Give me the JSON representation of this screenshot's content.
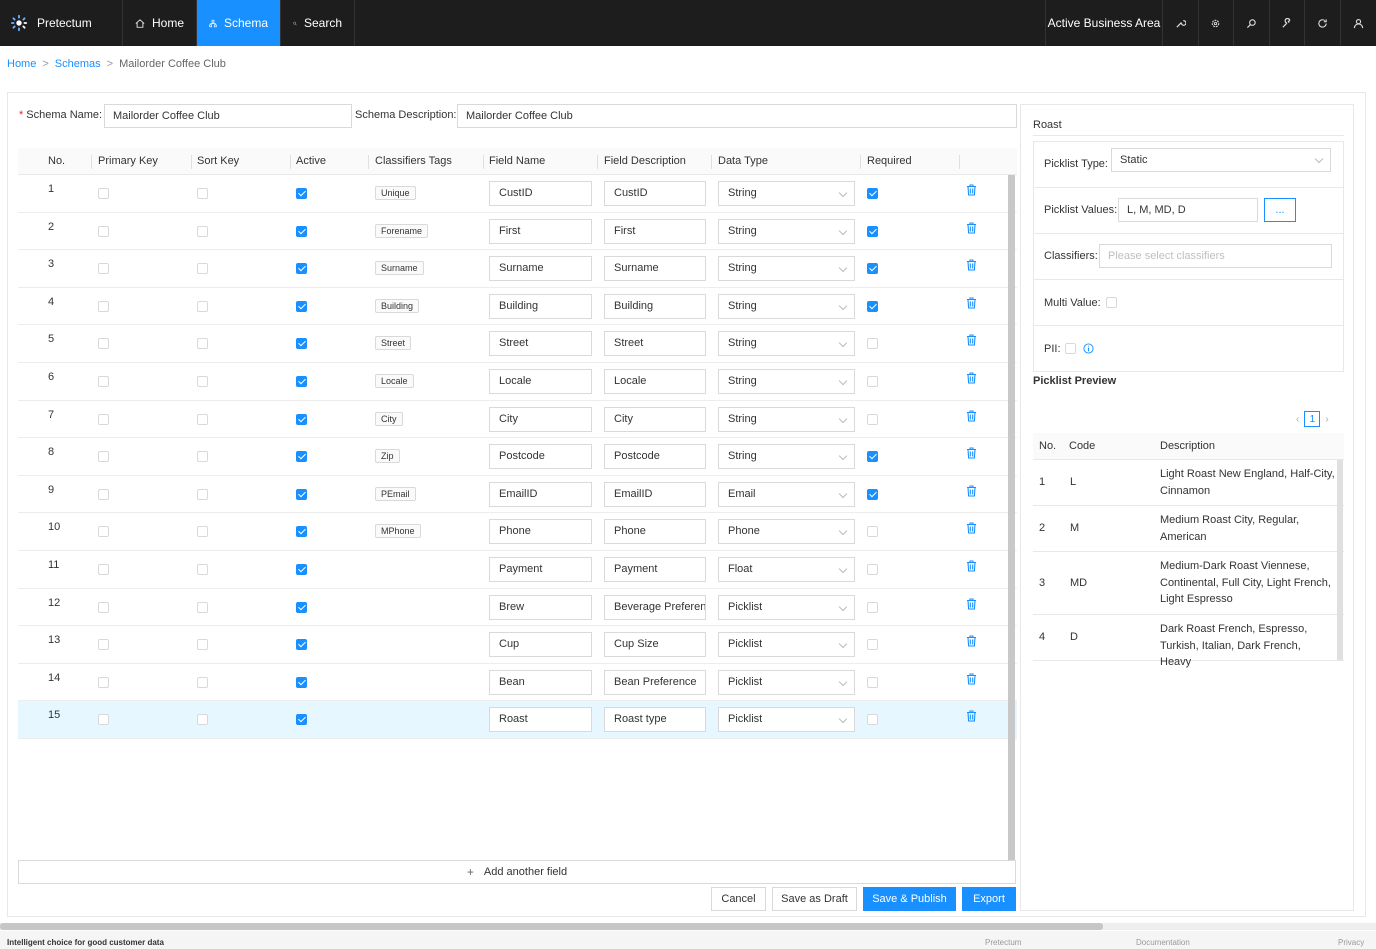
{
  "app": {
    "name": "Pretectum"
  },
  "nav": {
    "home": "Home",
    "schema": "Schema",
    "search": "Search"
  },
  "topbar": {
    "business_area": "Active Business Area"
  },
  "breadcrumb": {
    "home": "Home",
    "schemas": "Schemas",
    "current": "Mailorder Coffee Club",
    "sep": ">"
  },
  "form": {
    "schema_name_label": "Schema Name:",
    "schema_name_value": "Mailorder Coffee Club",
    "schema_desc_label": "Schema Description:",
    "schema_desc_value": "Mailorder Coffee Club"
  },
  "table": {
    "headers": {
      "no": "No.",
      "primary_key": "Primary Key",
      "sort_key": "Sort Key",
      "active": "Active",
      "classifiers": "Classifiers Tags",
      "field_name": "Field Name",
      "field_desc": "Field Description",
      "data_type": "Data Type",
      "required": "Required"
    },
    "rows": [
      {
        "no": "1",
        "tag": "Unique",
        "name": "CustID",
        "desc": "CustID",
        "type": "String",
        "required": true
      },
      {
        "no": "2",
        "tag": "Forename",
        "name": "First",
        "desc": "First",
        "type": "String",
        "required": true
      },
      {
        "no": "3",
        "tag": "Surname",
        "name": "Surname",
        "desc": "Surname",
        "type": "String",
        "required": true
      },
      {
        "no": "4",
        "tag": "Building",
        "name": "Building",
        "desc": "Building",
        "type": "String",
        "required": true
      },
      {
        "no": "5",
        "tag": "Street",
        "name": "Street",
        "desc": "Street",
        "type": "String",
        "required": false
      },
      {
        "no": "6",
        "tag": "Locale",
        "name": "Locale",
        "desc": "Locale",
        "type": "String",
        "required": false
      },
      {
        "no": "7",
        "tag": "City",
        "name": "City",
        "desc": "City",
        "type": "String",
        "required": false
      },
      {
        "no": "8",
        "tag": "Zip",
        "name": "Postcode",
        "desc": "Postcode",
        "type": "String",
        "required": true
      },
      {
        "no": "9",
        "tag": "PEmail",
        "name": "EmailID",
        "desc": "EmailID",
        "type": "Email",
        "required": true
      },
      {
        "no": "10",
        "tag": "MPhone",
        "name": "Phone",
        "desc": "Phone",
        "type": "Phone",
        "required": false
      },
      {
        "no": "11",
        "tag": "",
        "name": "Payment",
        "desc": "Payment",
        "type": "Float",
        "required": false
      },
      {
        "no": "12",
        "tag": "",
        "name": "Brew",
        "desc": "Beverage Preferen",
        "type": "Picklist",
        "required": false
      },
      {
        "no": "13",
        "tag": "",
        "name": "Cup",
        "desc": "Cup Size",
        "type": "Picklist",
        "required": false
      },
      {
        "no": "14",
        "tag": "",
        "name": "Bean",
        "desc": "Bean Preference",
        "type": "Picklist",
        "required": false
      },
      {
        "no": "15",
        "tag": "",
        "name": "Roast",
        "desc": "Roast type",
        "type": "Picklist",
        "required": false
      }
    ]
  },
  "actions": {
    "add_field": "Add another field",
    "cancel": "Cancel",
    "save_draft": "Save as Draft",
    "save_publish": "Save & Publish",
    "export": "Export"
  },
  "field_panel": {
    "title": "Roast",
    "picklist_type_label": "Picklist Type:",
    "picklist_type_value": "Static",
    "picklist_values_label": "Picklist Values:",
    "picklist_values_value": "L, M, MD, D",
    "picklist_values_button": "...",
    "classifiers_label": "Classifiers:",
    "classifiers_placeholder": "Please select classifiers",
    "multi_value_label": "Multi Value:",
    "pii_label": "PII:"
  },
  "picklist_preview": {
    "title": "Picklist Preview",
    "page": "1",
    "headers": {
      "no": "No.",
      "code": "Code",
      "description": "Description"
    },
    "rows": [
      {
        "no": "1",
        "code": "L",
        "description": "Light Roast New England, Half-City, Cinnamon"
      },
      {
        "no": "2",
        "code": "M",
        "description": "Medium Roast City, Regular, American"
      },
      {
        "no": "3",
        "code": "MD",
        "description": "Medium-Dark Roast Viennese, Continental, Full City, Light French, Light Espresso"
      },
      {
        "no": "4",
        "code": "D",
        "description": "Dark Roast French, Espresso, Turkish, Italian, Dark French, Heavy"
      }
    ]
  },
  "footer": {
    "tagline": "Intelligent choice for good customer data",
    "link_pretectum": "Pretectum",
    "link_docs": "Documentation",
    "link_privacy": "Privacy"
  },
  "colors": {
    "accent": "#1890ff",
    "topbar": "#1d1d1d"
  }
}
